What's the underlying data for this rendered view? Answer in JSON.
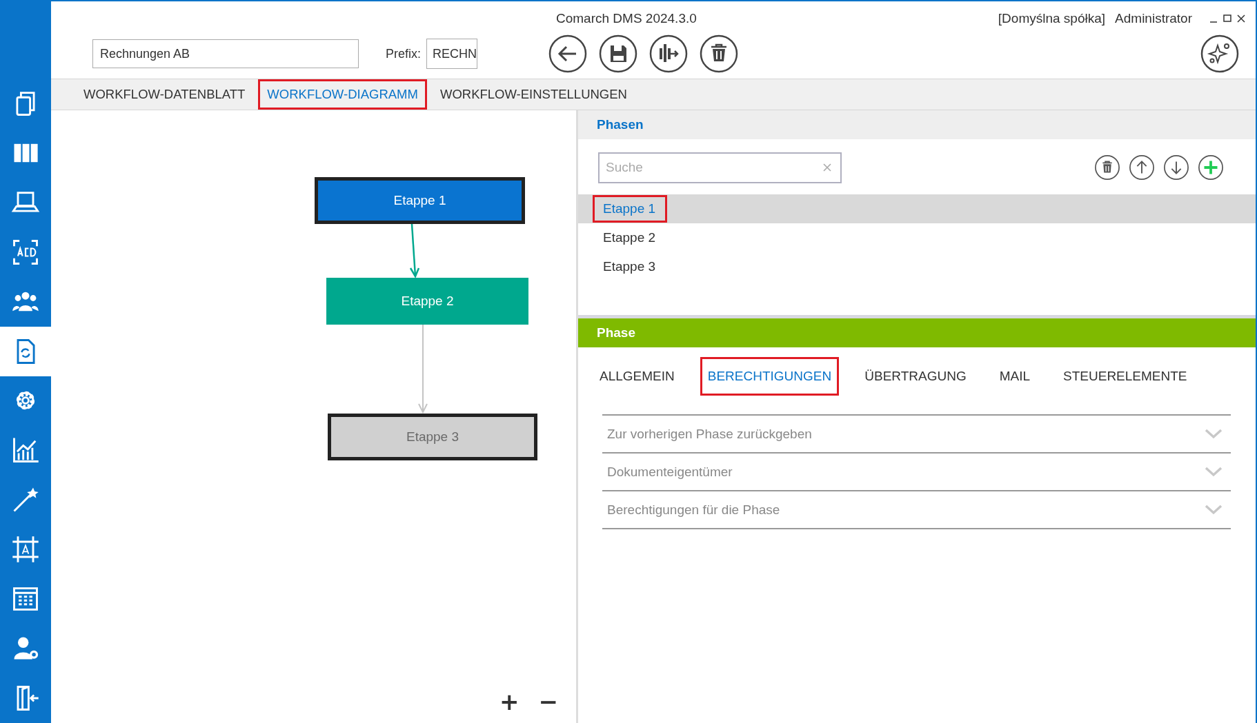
{
  "window": {
    "title": "Comarch DMS 2024.3.0",
    "company": "[Domyślna spółka]",
    "user": "Administrator"
  },
  "sidebar": {
    "items": [
      {
        "selected": false
      },
      {
        "selected": false
      },
      {
        "selected": false
      },
      {
        "selected": false
      },
      {
        "selected": false
      },
      {
        "selected": true
      },
      {
        "selected": false
      },
      {
        "selected": false
      },
      {
        "selected": false
      },
      {
        "selected": false
      },
      {
        "selected": false
      },
      {
        "selected": false
      },
      {
        "selected": false
      }
    ]
  },
  "header": {
    "name": "Rechnungen AB",
    "prefix_label": "Prefix:",
    "prefix": "RECHN"
  },
  "tabs": [
    {
      "label": "WORKFLOW-DATENBLATT",
      "selected": false,
      "highlighted": false
    },
    {
      "label": "WORKFLOW-DIAGRAMM",
      "selected": true,
      "highlighted": true
    },
    {
      "label": "WORKFLOW-EINSTELLUNGEN",
      "selected": false,
      "highlighted": false
    }
  ],
  "diagram": {
    "nodes": [
      {
        "label": "Etappe 1",
        "color": "#0a74d0",
        "outlined": true
      },
      {
        "label": "Etappe  2",
        "color": "#00a88e",
        "outlined": false
      },
      {
        "label": "Etappe 3",
        "color": "#d0d0d0",
        "outlined": true
      }
    ],
    "zoom_in": "+",
    "zoom_out": "−"
  },
  "phases": {
    "title": "Phasen",
    "search": {
      "placeholder": "Suche"
    },
    "items": [
      {
        "label": "Etappe 1",
        "selected": true,
        "highlighted": true
      },
      {
        "label": "Etappe  2",
        "selected": false,
        "highlighted": false
      },
      {
        "label": "Etappe 3",
        "selected": false,
        "highlighted": false
      }
    ]
  },
  "phase": {
    "title": "Phase",
    "tabs": [
      {
        "label": "ALLGEMEIN",
        "selected": false,
        "highlighted": false
      },
      {
        "label": "BERECHTIGUNGEN",
        "selected": true,
        "highlighted": true
      },
      {
        "label": "ÜBERTRAGUNG",
        "selected": false,
        "highlighted": false
      },
      {
        "label": "MAIL",
        "selected": false,
        "highlighted": false
      },
      {
        "label": "STEUERELEMENTE",
        "selected": false,
        "highlighted": false
      }
    ],
    "sections": [
      {
        "label": "Zur vorherigen Phase zurückgeben",
        "expanded": false
      },
      {
        "label": "Dokumenteigentümer",
        "expanded": false
      },
      {
        "label": "Berechtigungen für die Phase",
        "expanded": false
      }
    ]
  }
}
